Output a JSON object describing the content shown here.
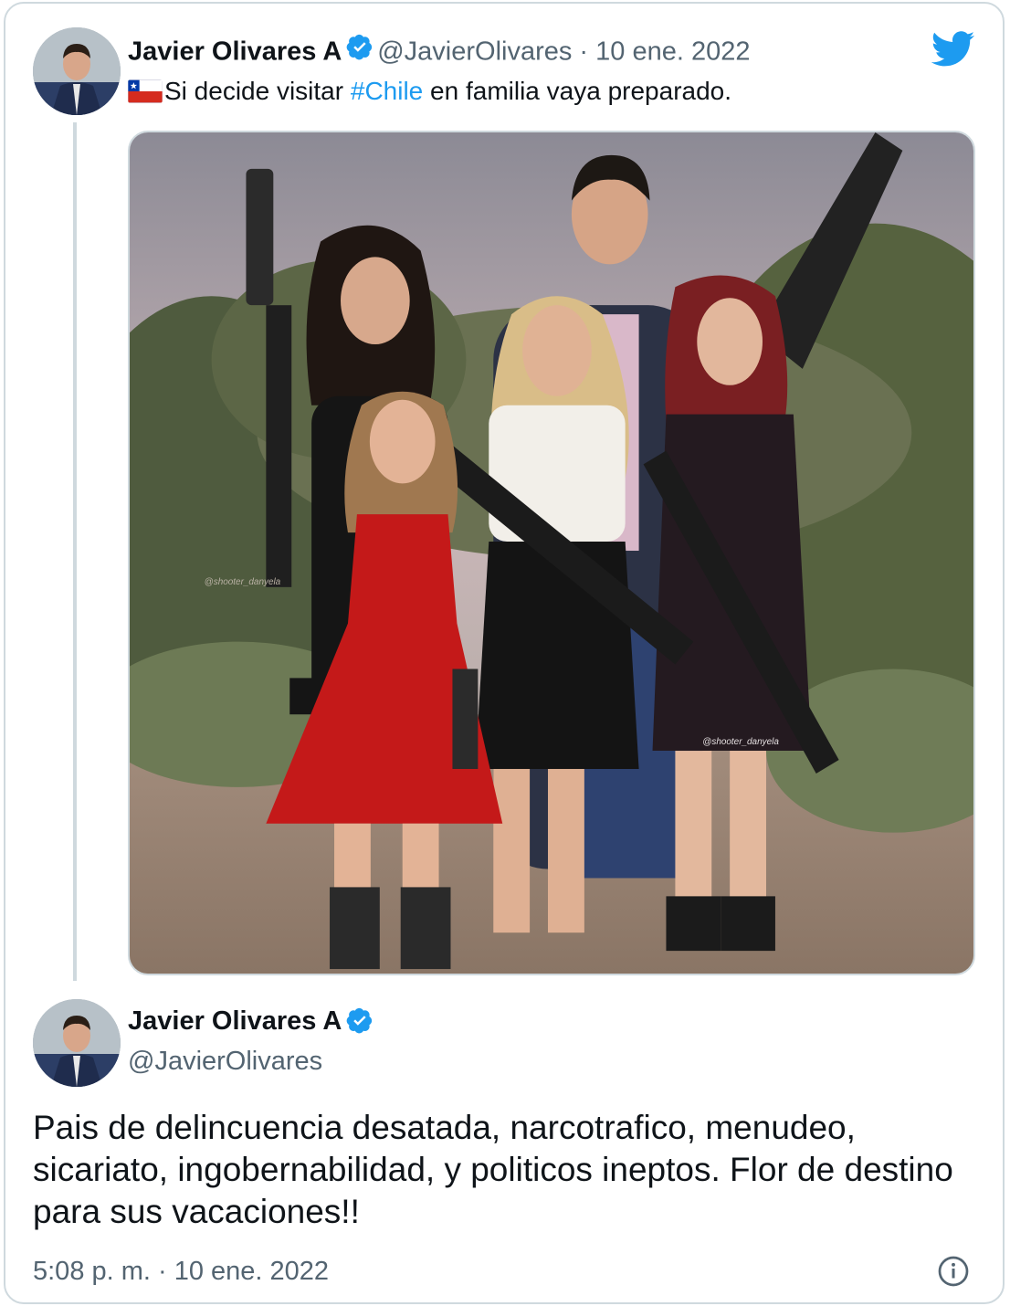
{
  "tweet": {
    "author_name": "Javier Olivares A",
    "handle": "@JavierOlivares",
    "separator": " · ",
    "date": "10 ene. 2022",
    "text_before": "Si decide visitar ",
    "hashtag": "#Chile",
    "text_after": " en familia vaya preparado.",
    "flag_icon": "chile-flag-icon",
    "media_watermark_1": "@shooter_danyela",
    "media_watermark_2": "@shooter_danyela"
  },
  "reply": {
    "author_name": "Javier Olivares A",
    "handle": "@JavierOlivares",
    "text": "Pais de delincuencia desatada, narcotrafico, menudeo, sicariato, ingobernabilidad, y politicos ineptos. Flor de destino para sus vacaciones!!",
    "timestamp": "5:08 p. m. · 10 ene. 2022"
  },
  "colors": {
    "twitter_blue": "#1d9bf0",
    "border": "#cfd9de",
    "secondary_text": "#536471"
  }
}
